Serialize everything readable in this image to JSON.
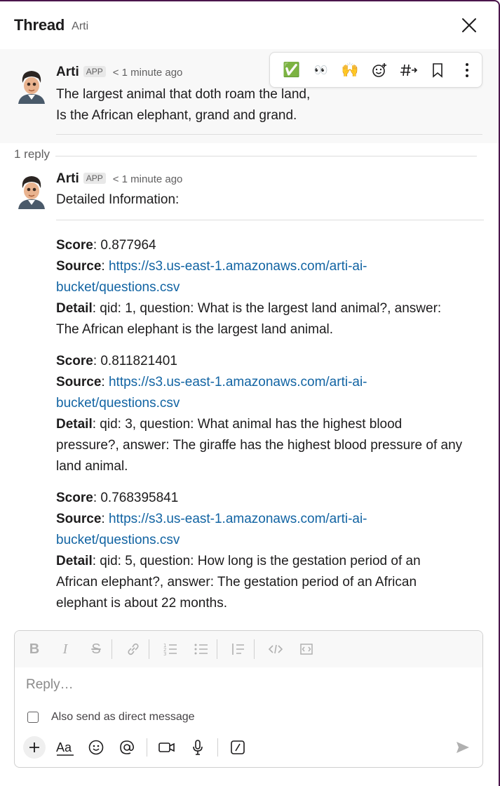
{
  "header": {
    "title": "Thread",
    "subtitle": "Arti"
  },
  "parent_message": {
    "author": "Arti",
    "badge": "APP",
    "time": "< 1 minute ago",
    "lines": [
      "The largest animal that doth roam the land,",
      "Is the African elephant, grand and grand."
    ]
  },
  "message_toolbar": {
    "icons": [
      "check-mark-emoji",
      "eyes-emoji",
      "raised-hands-emoji",
      "add-reaction",
      "reply-in-channel",
      "bookmark",
      "more-actions"
    ],
    "emoji_check": "✅",
    "emoji_eyes": "👀",
    "emoji_hands": "🙌"
  },
  "thread": {
    "reply_count": "1 reply"
  },
  "reply_message": {
    "author": "Arti",
    "badge": "APP",
    "time": "< 1 minute ago",
    "heading": "Detailed Information:",
    "score_label": "Score",
    "source_label": "Source",
    "detail_label": "Detail",
    "results": [
      {
        "score": ": 0.877964",
        "source_line1": "https://s3.us-east-1.amazonaws.com/arti-ai-",
        "source_line2": "bucket/questions.csv",
        "detail_line1": ": qid: 1, question: What is the largest land animal?, answer:",
        "detail_line2": "The African elephant is the largest land animal."
      },
      {
        "score": ": 0.811821401",
        "source_line1": "https://s3.us-east-1.amazonaws.com/arti-ai-",
        "source_line2": "bucket/questions.csv",
        "detail_line1": ": qid: 3, question: What animal has the highest blood",
        "detail_line2": "pressure?, answer: The giraffe has the highest blood pressure of any",
        "detail_line3": "land animal."
      },
      {
        "score": ": 0.768395841",
        "source_line1": "https://s3.us-east-1.amazonaws.com/arti-ai-",
        "source_line2": "bucket/questions.csv",
        "detail_line1": ": qid: 5, question: How long is the gestation period of an",
        "detail_line2": "African elephant?, answer: The gestation period of an African",
        "detail_line3": "elephant is about 22 months."
      }
    ]
  },
  "composer": {
    "placeholder": "Reply…",
    "dm_label": "Also send as direct message",
    "format_icons": [
      "bold",
      "italic",
      "strikethrough",
      "link",
      "ordered-list",
      "bulleted-list",
      "blockquote",
      "code",
      "code-block"
    ],
    "bottom_icons": [
      "plus",
      "formatting",
      "emoji",
      "mention",
      "video",
      "microphone",
      "slash-command",
      "send"
    ]
  },
  "colors": {
    "link": "#1264a3",
    "accent": "#4a154b"
  }
}
